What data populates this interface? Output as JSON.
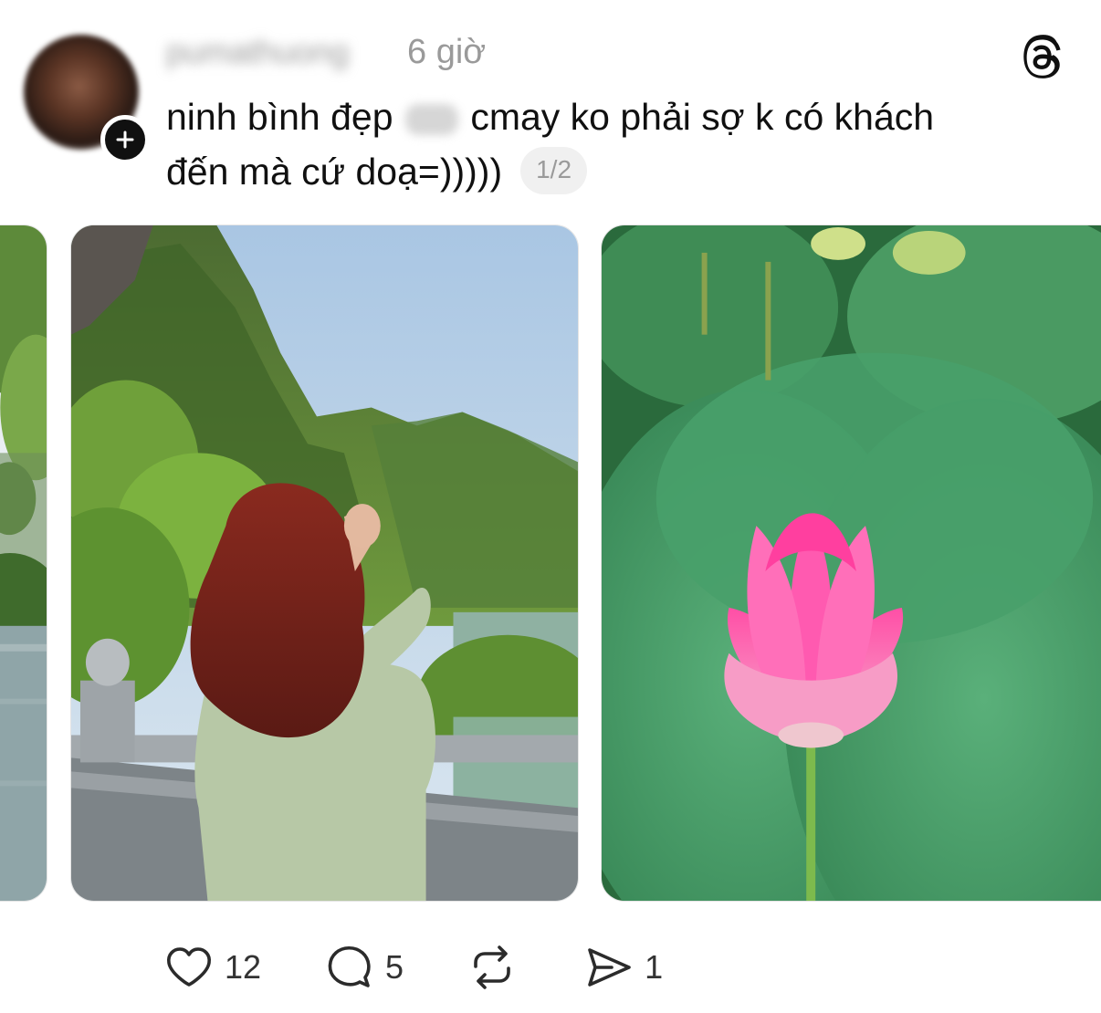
{
  "post": {
    "username": "pumathuong",
    "timestamp": "6 giờ",
    "caption_line1_part1": "ninh bình đẹp",
    "caption_line1_part2": "cmay ko phải sợ k có khách",
    "caption_line2": "đến mà cứ doạ=)))))",
    "page_counter": "1/2"
  },
  "images": [
    {
      "description": "previous photo partially visible - trees and lake"
    },
    {
      "description": "woman with red hair looking at green mountains in Ninh Binh"
    },
    {
      "description": "pink lotus flower among green lotus leaves"
    }
  ],
  "actions": {
    "likes": "12",
    "comments": "5",
    "shares": "1"
  },
  "icons": [
    "plus-icon",
    "threads-logo-icon",
    "heart-icon",
    "comment-icon",
    "repost-icon",
    "send-icon"
  ]
}
